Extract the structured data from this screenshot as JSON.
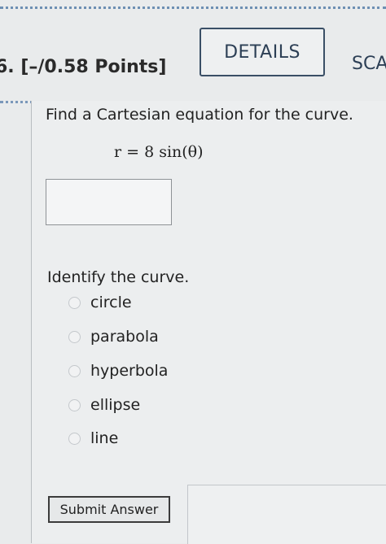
{
  "header": {
    "points_label": "6. [–/0.58 Points]",
    "details_label": "DETAILS",
    "next_button_label": "SCA"
  },
  "question": {
    "prompt": "Find a Cartesian equation for the curve.",
    "equation": "r = 8 sin(θ)",
    "answer_value": ""
  },
  "identify": {
    "prompt": "Identify the curve.",
    "options": [
      "circle",
      "parabola",
      "hyperbola",
      "ellipse",
      "line"
    ],
    "selected": null
  },
  "footer": {
    "submit_label": "Submit Answer"
  }
}
